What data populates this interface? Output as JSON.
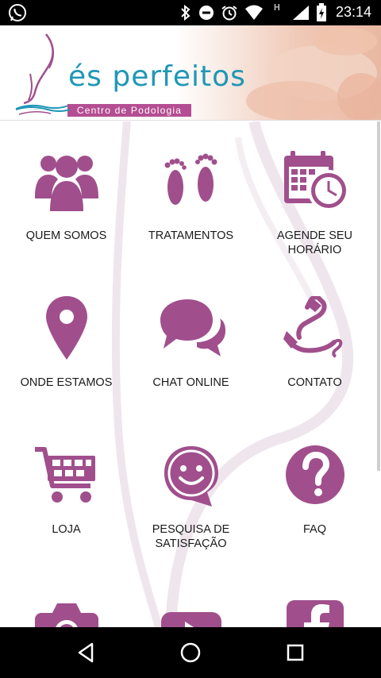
{
  "status_bar": {
    "time": "23:14",
    "icons": [
      "whatsapp-icon",
      "bluetooth-icon",
      "do-not-disturb-icon",
      "alarm-icon",
      "wifi-icon",
      "signal-icon",
      "battery-icon"
    ]
  },
  "header": {
    "brand_name": "és perfeitos",
    "subtitle": "Centro de Podologia"
  },
  "menu": {
    "items": [
      {
        "label": "QUEM SOMOS",
        "icon": "people-icon"
      },
      {
        "label": "TRATAMENTOS",
        "icon": "footprints-icon"
      },
      {
        "label": "AGENDE SEU\nHORÁRIO",
        "icon": "calendar-clock-icon"
      },
      {
        "label": "ONDE ESTAMOS",
        "icon": "location-pin-icon"
      },
      {
        "label": "CHAT ONLINE",
        "icon": "chat-bubbles-icon"
      },
      {
        "label": "CONTATO",
        "icon": "phone-icon"
      },
      {
        "label": "LOJA",
        "icon": "shopping-cart-icon"
      },
      {
        "label": "PESQUISA DE\nSATISFAÇÃO",
        "icon": "smiley-bubble-icon"
      },
      {
        "label": "FAQ",
        "icon": "question-icon"
      },
      {
        "label": "",
        "icon": "camera-icon"
      },
      {
        "label": "",
        "icon": "video-play-icon"
      },
      {
        "label": "",
        "icon": "facebook-icon"
      }
    ]
  },
  "colors": {
    "accent": "#a04f8c",
    "brand_blue": "#1f97b6",
    "subtitle_bg": "#b44e93"
  },
  "navbar": {
    "icons": [
      "back-icon",
      "home-icon",
      "recents-icon"
    ]
  }
}
